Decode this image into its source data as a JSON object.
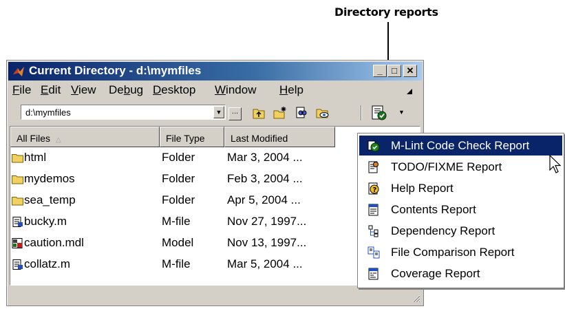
{
  "callout": {
    "label": "Directory reports"
  },
  "window": {
    "title": "Current Directory - d:\\mymfiles",
    "controls": {
      "minimize": "_",
      "maximize": "□",
      "close": "✕"
    }
  },
  "menubar": {
    "items": [
      {
        "pre": "",
        "u": "F",
        "post": "ile"
      },
      {
        "pre": "",
        "u": "E",
        "post": "dit"
      },
      {
        "pre": "",
        "u": "V",
        "post": "iew"
      },
      {
        "pre": "De",
        "u": "b",
        "post": "ug"
      },
      {
        "pre": "",
        "u": "D",
        "post": "esktop"
      },
      {
        "pre": "",
        "u": "W",
        "post": "indow"
      },
      {
        "pre": "",
        "u": "H",
        "post": "elp"
      }
    ]
  },
  "toolbar": {
    "path_value": "d:\\mymfiles",
    "browse_label": "..."
  },
  "file_table": {
    "columns": [
      "All Files",
      "File Type",
      "Last Modified"
    ],
    "rows": [
      {
        "name": "html",
        "type": "Folder",
        "modified": "Mar 3, 2004 ...",
        "icon": "folder-icon"
      },
      {
        "name": "mydemos",
        "type": "Folder",
        "modified": "Feb 3, 2004 ...",
        "icon": "folder-icon"
      },
      {
        "name": "sea_temp",
        "type": "Folder",
        "modified": "Apr 5, 2004 ...",
        "icon": "folder-icon"
      },
      {
        "name": "bucky.m",
        "type": "M-file",
        "modified": "Nov 27, 1997...",
        "icon": "m-file-icon"
      },
      {
        "name": "caution.mdl",
        "type": "Model",
        "modified": "Nov 13, 1997...",
        "icon": "model-file-icon"
      },
      {
        "name": "collatz.m",
        "type": "M-file",
        "modified": "Mar 5, 2004 ...",
        "icon": "m-file-icon"
      }
    ]
  },
  "reports_menu": {
    "items": [
      {
        "label": "M-Lint Code Check Report",
        "icon": "mlint-icon",
        "selected": true
      },
      {
        "label": "TODO/FIXME Report",
        "icon": "todo-icon"
      },
      {
        "label": "Help Report",
        "icon": "help-report-icon"
      },
      {
        "label": "Contents Report",
        "icon": "contents-report-icon"
      },
      {
        "label": "Dependency Report",
        "icon": "dependency-report-icon"
      },
      {
        "label": "File Comparison Report",
        "icon": "file-comparison-icon"
      },
      {
        "label": "Coverage Report",
        "icon": "coverage-report-icon"
      }
    ]
  },
  "colors": {
    "title_start": "#0a246a",
    "title_end": "#a6caf0",
    "selection": "#0a246a",
    "face": "#d4d0c8"
  }
}
